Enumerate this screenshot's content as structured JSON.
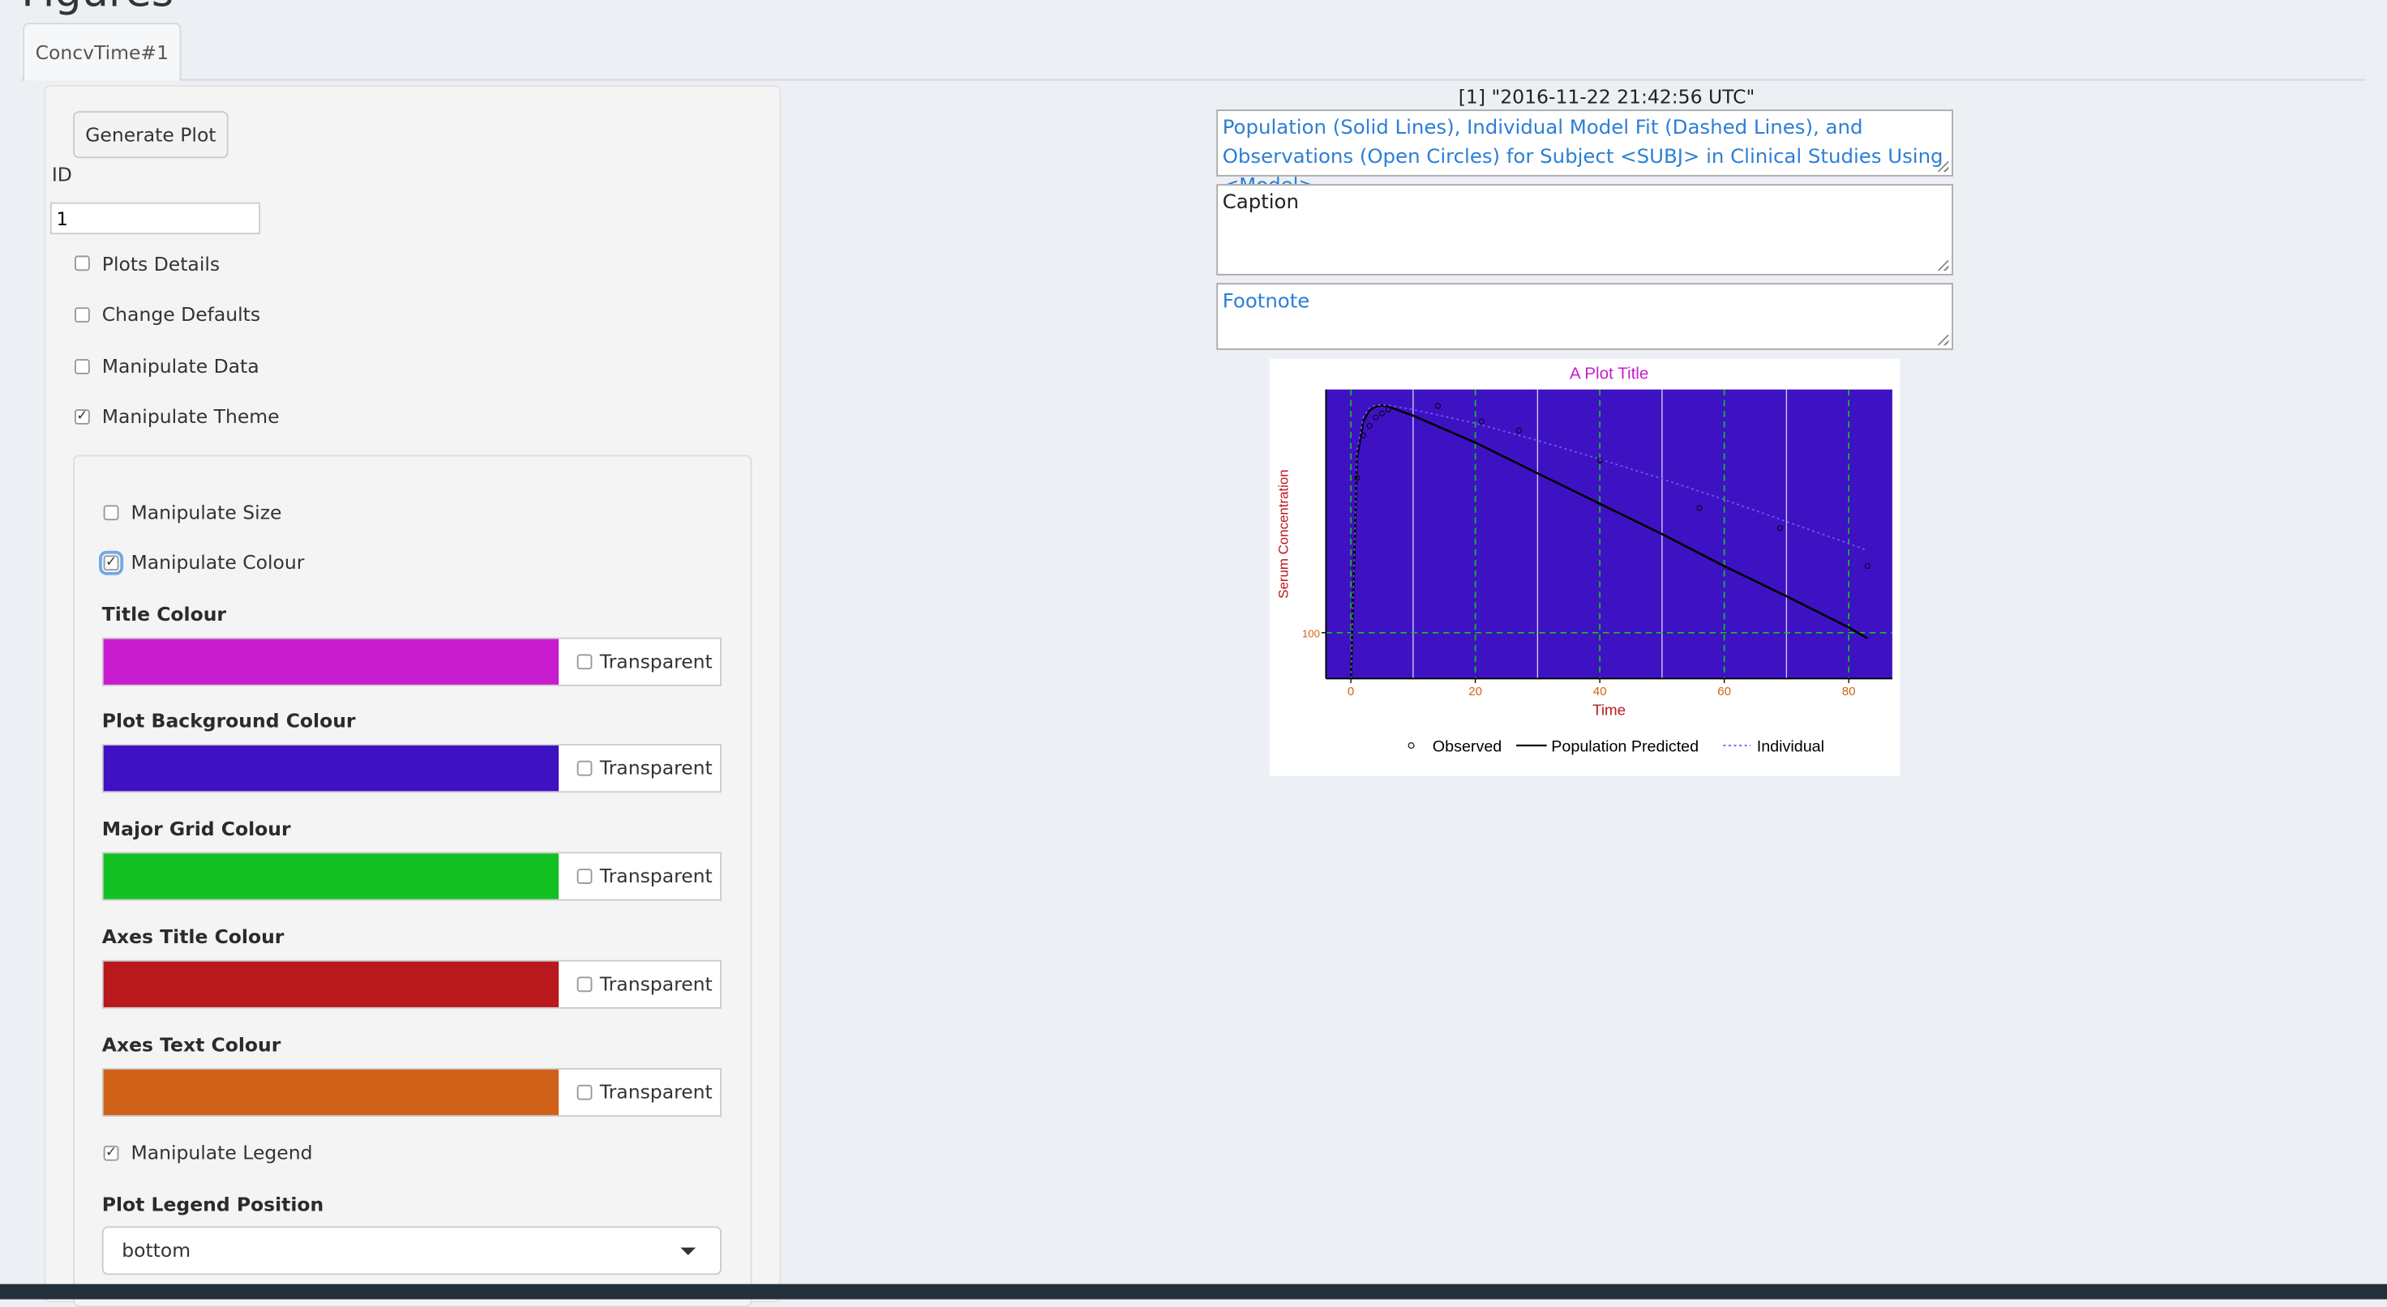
{
  "page": {
    "title": "Figures"
  },
  "tabs": [
    {
      "label": "ConcvTime#1"
    }
  ],
  "controls": {
    "generate_label": "Generate Plot",
    "id_label": "ID",
    "id_value": "1",
    "checkboxes": [
      {
        "label": "Plots Details",
        "checked": false
      },
      {
        "label": "Change Defaults",
        "checked": false
      },
      {
        "label": "Manipulate Data",
        "checked": false
      },
      {
        "label": "Manipulate Theme",
        "checked": true
      }
    ],
    "theme": {
      "manipulate_size": {
        "label": "Manipulate Size",
        "checked": false
      },
      "manipulate_colour": {
        "label": "Manipulate Colour",
        "checked": true
      },
      "colours": [
        {
          "label": "Title Colour",
          "color": "#c81ccf",
          "transparent_label": "Transparent"
        },
        {
          "label": "Plot Background Colour",
          "color": "#3e12c2",
          "transparent_label": "Transparent"
        },
        {
          "label": "Major Grid Colour",
          "color": "#13c124",
          "transparent_label": "Transparent"
        },
        {
          "label": "Axes Title Colour",
          "color": "#b9181c",
          "transparent_label": "Transparent"
        },
        {
          "label": "Axes Text Colour",
          "color": "#cf6119",
          "transparent_label": "Transparent"
        }
      ],
      "manipulate_legend": {
        "label": "Manipulate Legend",
        "checked": true
      },
      "legend_position_label": "Plot Legend Position",
      "legend_position_value": "bottom"
    }
  },
  "output": {
    "timestamp": "[1] \"2016-11-22 21:42:56 UTC\"",
    "title_text": "Population (Solid Lines), Individual Model Fit (Dashed Lines), and Observations (Open Circles) for Subject <SUBJ> in Clinical Studies Using <Model>",
    "caption_text": "Caption",
    "footnote_text": "Footnote"
  },
  "chart_data": {
    "type": "line",
    "title": "A Plot Title",
    "xlabel": "Time",
    "ylabel": "Serum Concentration",
    "xlim": [
      -4,
      87
    ],
    "x_ticks": [
      0,
      20,
      40,
      60,
      80
    ],
    "y_ticks": [
      100
    ],
    "y_scale": "log",
    "ylim": [
      60,
      1500
    ],
    "grid": true,
    "colors": {
      "title": "#c81ccf",
      "background": "#3e12c2",
      "major_grid": "#13c124",
      "axes_title": "#b9181c",
      "axes_text": "#cf6119"
    },
    "legend_position": "bottom",
    "legend": [
      "Observed",
      "Population Predicted",
      "Individual"
    ],
    "series": [
      {
        "name": "Population Predicted",
        "style": "solid",
        "points": [
          [
            0,
            60
          ],
          [
            1,
            700
          ],
          [
            2,
            1050
          ],
          [
            3,
            1190
          ],
          [
            4,
            1240
          ],
          [
            5,
            1255
          ],
          [
            6,
            1240
          ],
          [
            10,
            1120
          ],
          [
            20,
            830
          ],
          [
            30,
            590
          ],
          [
            40,
            420
          ],
          [
            50,
            300
          ],
          [
            60,
            210
          ],
          [
            70,
            150
          ],
          [
            80,
            106
          ],
          [
            83,
            94
          ]
        ]
      },
      {
        "name": "Individual",
        "style": "dotted",
        "points": [
          [
            0,
            60
          ],
          [
            1,
            750
          ],
          [
            2,
            1100
          ],
          [
            3,
            1220
          ],
          [
            4,
            1260
          ],
          [
            6,
            1260
          ],
          [
            10,
            1200
          ],
          [
            20,
            1030
          ],
          [
            30,
            850
          ],
          [
            40,
            690
          ],
          [
            50,
            555
          ],
          [
            60,
            440
          ],
          [
            70,
            345
          ],
          [
            80,
            270
          ],
          [
            83,
            250
          ]
        ]
      },
      {
        "name": "Observed",
        "style": "points",
        "points": [
          [
            1,
            560
          ],
          [
            2,
            900
          ],
          [
            3,
            1000
          ],
          [
            4,
            1100
          ],
          [
            5,
            1150
          ],
          [
            6,
            1200
          ],
          [
            14,
            1250
          ],
          [
            21,
            1050
          ],
          [
            27,
            950
          ],
          [
            40,
            680
          ],
          [
            56,
            400
          ],
          [
            69,
            320
          ],
          [
            83,
            210
          ]
        ]
      }
    ]
  }
}
